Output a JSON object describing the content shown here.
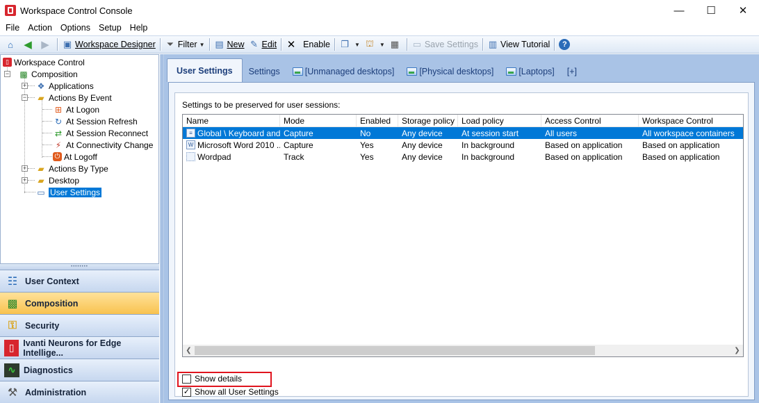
{
  "window": {
    "title": "Workspace Control Console",
    "minimize": "—",
    "maximize": "☐",
    "close": "✕"
  },
  "menu": [
    "File",
    "Action",
    "Options",
    "Setup",
    "Help"
  ],
  "toolbar": {
    "workspace_designer": "Workspace Designer",
    "filter": "Filter",
    "new": "New",
    "edit": "Edit",
    "enable": "Enable",
    "save_settings": "Save Settings",
    "view_tutorial": "View Tutorial"
  },
  "tree": {
    "root": "Workspace Control",
    "composition": "Composition",
    "applications": "Applications",
    "actions_by_event": "Actions By Event",
    "at_logon": "At Logon",
    "at_session_refresh": "At Session Refresh",
    "at_session_reconnect": "At Session Reconnect",
    "at_connectivity_change": "At Connectivity Change",
    "at_logoff": "At Logoff",
    "actions_by_type": "Actions By Type",
    "desktop": "Desktop",
    "user_settings": "User Settings"
  },
  "nav": {
    "user_context": "User Context",
    "composition": "Composition",
    "security": "Security",
    "ivanti": "Ivanti Neurons for Edge Intellige...",
    "diagnostics": "Diagnostics",
    "administration": "Administration"
  },
  "tabs": {
    "user_settings": "User Settings",
    "settings": "Settings",
    "unmanaged": "[Unmanaged desktops]",
    "physical": "[Physical desktops]",
    "laptops": "[Laptops]",
    "add": "[+]"
  },
  "panel": {
    "label": "Settings to be preserved for user sessions:",
    "columns": [
      "Name",
      "Mode",
      "Enabled",
      "Storage policy",
      "Load policy",
      "Access Control",
      "Workspace Control"
    ],
    "rows": [
      [
        "Global \\ Keyboard and...",
        "Capture",
        "No",
        "Any device",
        "At session start",
        "All users",
        "All workspace containers"
      ],
      [
        "Microsoft Word 2010 ...",
        "Capture",
        "Yes",
        "Any device",
        "In background",
        "Based on application",
        "Based on application"
      ],
      [
        "Wordpad",
        "Track",
        "Yes",
        "Any device",
        "In background",
        "Based on application",
        "Based on application"
      ]
    ],
    "show_details": "Show details",
    "show_all": "Show all User Settings",
    "show_details_checked": false,
    "show_all_checked": true
  },
  "colors": {
    "selection": "#0078d7",
    "active_nav": "#f8c24f",
    "highlight_box": "#e0141e"
  }
}
